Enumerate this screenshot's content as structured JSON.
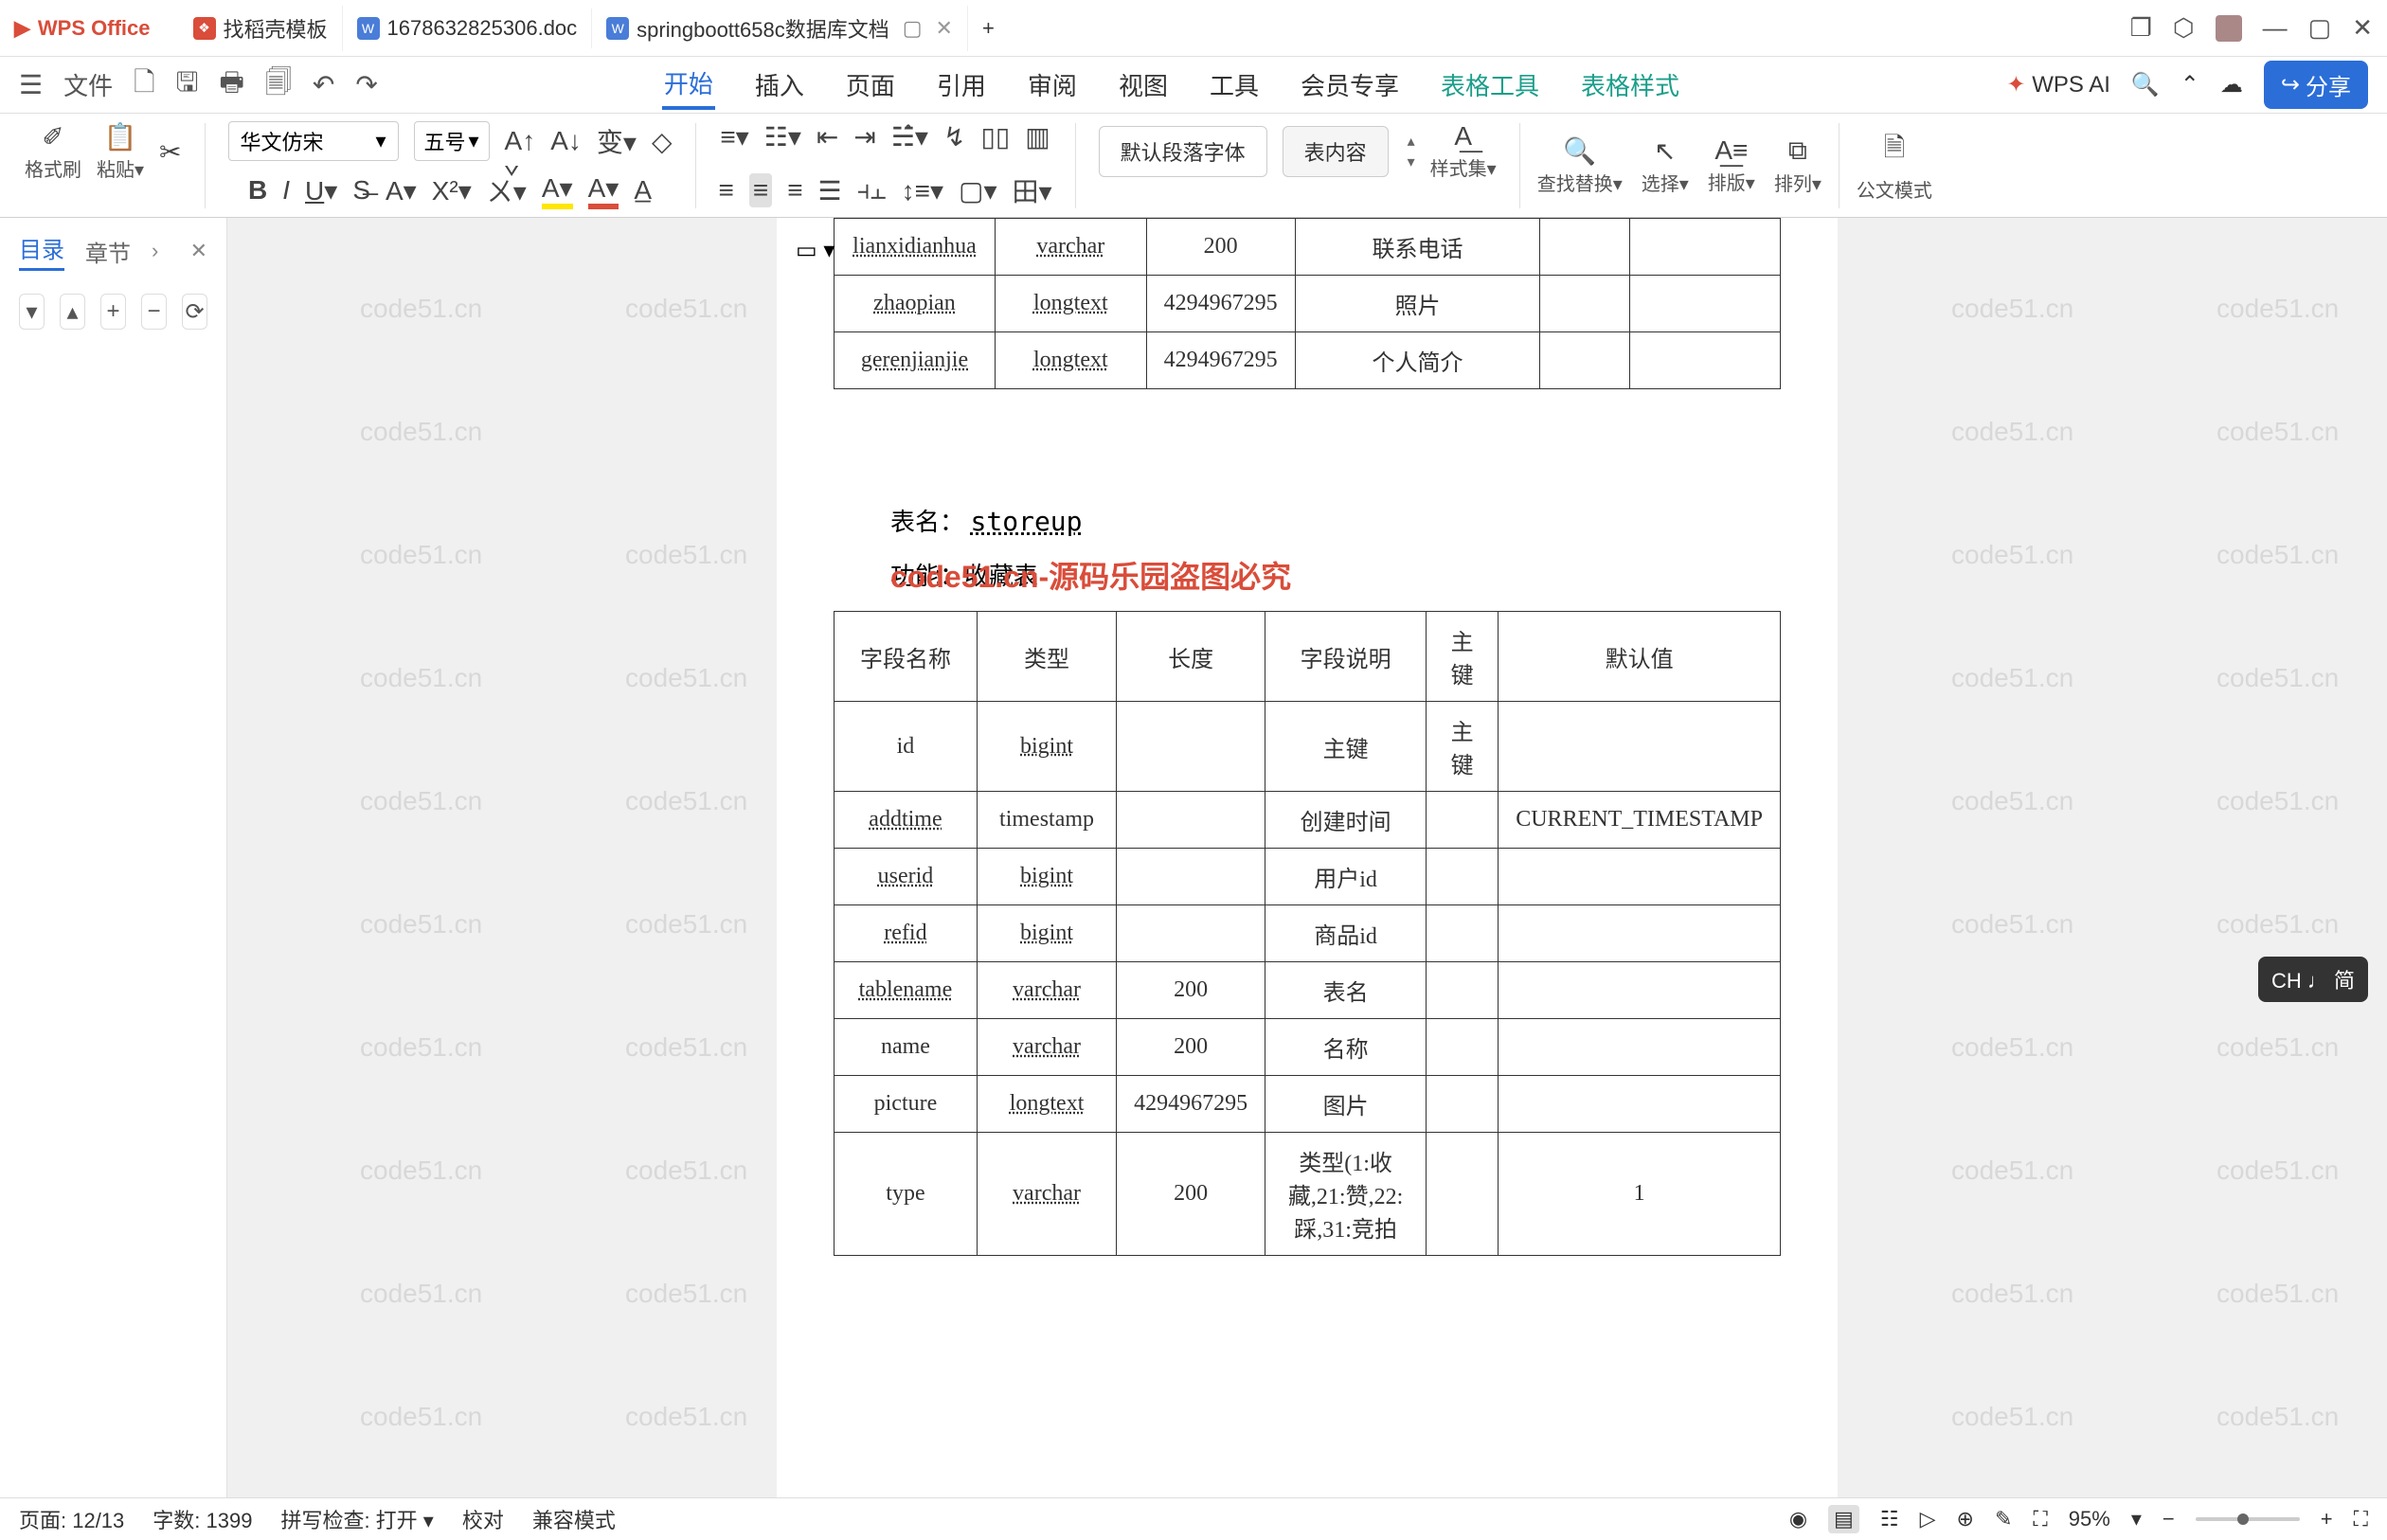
{
  "title": {
    "app": "WPS Office",
    "tabs": [
      {
        "icon": "red",
        "label": "找稻壳模板"
      },
      {
        "icon": "blue",
        "label": "1678632825306.doc"
      },
      {
        "icon": "blue",
        "label": "springboott658c数据库文档",
        "active": true
      }
    ],
    "new_tab": "+"
  },
  "menu": {
    "file": "文件",
    "items": [
      "开始",
      "插入",
      "页面",
      "引用",
      "审阅",
      "视图",
      "工具",
      "会员专享",
      "表格工具",
      "表格样式"
    ],
    "active": "开始",
    "ai": "WPS AI",
    "share": "分享"
  },
  "ribbon": {
    "format_brush": "格式刷",
    "paste": "粘贴",
    "font_name": "华文仿宋",
    "font_size": "五号",
    "style1": "默认段落字体",
    "style2": "表内容",
    "styles": "样式集",
    "find": "查找替换",
    "select": "选择",
    "sort": "排版",
    "arrange": "排列",
    "official": "公文模式"
  },
  "left_panel": {
    "tab1": "目录",
    "tab2": "章节"
  },
  "doc": {
    "page_control": "▭ ▾",
    "table1_rows": [
      {
        "c1": "lianxidianhua",
        "c2": "varchar",
        "c3": "200",
        "c4": "联系电话",
        "c5": "",
        "c6": ""
      },
      {
        "c1": "zhaopian",
        "c2": "longtext",
        "c3": "4294967295",
        "c4": "照片",
        "c5": "",
        "c6": ""
      },
      {
        "c1": "gerenjianjie",
        "c2": "longtext",
        "c3": "4294967295",
        "c4": "个人简介",
        "c5": "",
        "c6": ""
      }
    ],
    "tname_label": "表名：",
    "tname": "storeup",
    "func_prefix": "功能",
    "func_name": "收藏表",
    "overlay": "code51.cn-源码乐园盗图必究",
    "headers": [
      "字段名称",
      "类型",
      "长度",
      "字段说明",
      "主键",
      "默认值"
    ],
    "table2_rows": [
      {
        "c1": "id",
        "c2": "bigint",
        "c3": "",
        "c4": "主键",
        "c5": "主键",
        "c6": ""
      },
      {
        "c1": "addtime",
        "c2": "timestamp",
        "c3": "",
        "c4": "创建时间",
        "c5": "",
        "c6": "CURRENT_TIMESTAMP"
      },
      {
        "c1": "userid",
        "c2": "bigint",
        "c3": "",
        "c4": "用户id",
        "c5": "",
        "c6": ""
      },
      {
        "c1": "refid",
        "c2": "bigint",
        "c3": "",
        "c4": "商品id",
        "c5": "",
        "c6": ""
      },
      {
        "c1": "tablename",
        "c2": "varchar",
        "c3": "200",
        "c4": "表名",
        "c5": "",
        "c6": ""
      },
      {
        "c1": "name",
        "c2": "varchar",
        "c3": "200",
        "c4": "名称",
        "c5": "",
        "c6": ""
      },
      {
        "c1": "picture",
        "c2": "longtext",
        "c3": "4294967295",
        "c4": "图片",
        "c5": "",
        "c6": ""
      },
      {
        "c1": "type",
        "c2": "varchar",
        "c3": "200",
        "c4": "类型(1:收藏,21:赞,22:踩,31:竞拍",
        "c5": "",
        "c6": "1"
      }
    ]
  },
  "status": {
    "page": "页面: 12/13",
    "words": "字数: 1399",
    "spell": "拼写检查: 打开",
    "proof": "校对",
    "compat": "兼容模式",
    "zoom": "95%"
  },
  "ime": "CH ♩ 简",
  "watermark": "code51.cn"
}
